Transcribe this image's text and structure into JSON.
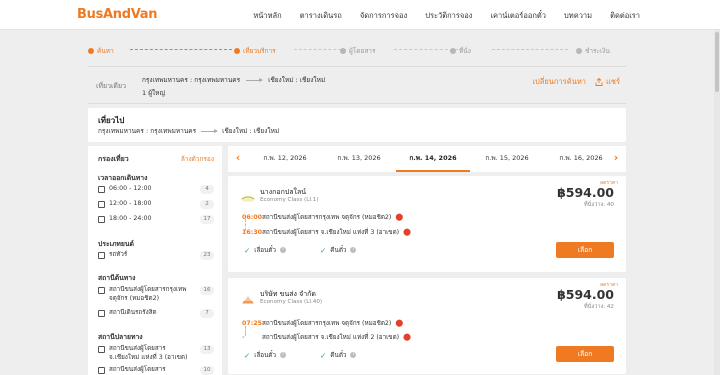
{
  "header": {
    "logo": "BusAndVan",
    "nav": [
      "หน้าหลัก",
      "ตารางเดินรถ",
      "จัดการการจอง",
      "ประวัติการจอง",
      "เคาน์เตอร์ออกตั๋ว",
      "บทความ",
      "ติดต่อเรา"
    ]
  },
  "steps": [
    "ค้นหา",
    "เที่ยวบริการ",
    "ผู้โดยสาร",
    "ที่นั่ง",
    "ชำระเงิน"
  ],
  "steps_active_count": 2,
  "summary": {
    "trip_type": "เที่ยวเดียว",
    "origin": "กรุงเทพมหานคร : กรุงเทพมหานคร",
    "destination": "เชียงใหม่ : เชียงใหม่",
    "passengers": "1 ผู้ใหญ่",
    "change_search": "เปลี่ยนการค้นหา",
    "share": "แชร์"
  },
  "outbound": {
    "title": "เที่ยวไป",
    "origin": "กรุงเทพมหานคร : กรุงเทพมหานคร",
    "destination": "เชียงใหม่ : เชียงใหม่"
  },
  "filters": {
    "heading": "กรองเที่ยว",
    "clear": "ล้างตัวกรอง",
    "departure_title": "เวลาออกเดินทาง",
    "departure": [
      {
        "label": "06:00 - 12:00",
        "count": "4"
      },
      {
        "label": "12:00 - 18:00",
        "count": "2"
      },
      {
        "label": "18:00 - 24:00",
        "count": "17"
      }
    ],
    "vehicle_title": "ประเภทยนต์",
    "vehicle": [
      {
        "label": "รถทัวร์",
        "count": "23"
      }
    ],
    "origin_title": "สถานีต้นทาง",
    "origin": [
      {
        "label": "สถานีขนส่งผู้โดยสารกรุงเทพ จตุจักร (หมอชิต2)",
        "count": "16"
      },
      {
        "label": "สถานีเดินรถรังสิต",
        "count": "7"
      }
    ],
    "destination_title": "สถานีปลายทาง",
    "destination": [
      {
        "label": "สถานีขนส่งผู้โดยสาร จ.เชียงใหม่ แห่งที่ 3 (อาเขต)",
        "count": "13"
      },
      {
        "label": "สถานีขนส่งผู้โดยสาร",
        "count": "10"
      }
    ]
  },
  "dates": [
    "ก.พ. 12, 2026",
    "ก.พ. 13, 2026",
    "ก.พ. 14, 2026",
    "ก.พ. 15, 2026",
    "ก.พ. 16, 2026"
  ],
  "dates_active_index": 2,
  "trips": [
    {
      "flag": "ลดราคา",
      "operator": "นางกอกปลใลน์",
      "class": "Economy Class (LI.1)",
      "price": "฿594.00",
      "seats": "ที่นั่งว่าง: 40",
      "dep_time": "06:00",
      "dep_station": "สถานีขนส่งผู้โดยสารกรุงเทพ จตุจักร (หมอชิต2)",
      "arr_time": "16:30",
      "arr_station": "สถานีขนส่งผู้โดยสาร จ.เชียงใหม่ แห่งที่ 3 (อาเขต)",
      "feat1": "เลื่อนตั๋ว",
      "feat2": "คืนตั๋ว",
      "button": "เลือก"
    },
    {
      "flag": "ลดราคา",
      "operator": "บริษัท ขนส่ง จำกัด",
      "class": "Economy Class (LI.40)",
      "price": "฿594.00",
      "seats": "ที่นั่งว่าง: 42",
      "dep_time": "07:25",
      "dep_station": "สถานีขนส่งผู้โดยสารกรุงเทพ จตุจักร (หมอชิต2)",
      "arr_time": "-",
      "arr_station": "สถานีขนส่งผู้โดยสาร จ.เชียงใหม่ แห่งที่ 2 (อาเขต)",
      "feat1": "เลื่อนตั๋ว",
      "feat2": "คืนตั๋ว",
      "button": "เลือก"
    }
  ],
  "colors": {
    "accent": "#f07a21",
    "success": "#3aa457",
    "pin": "#e2412b"
  }
}
